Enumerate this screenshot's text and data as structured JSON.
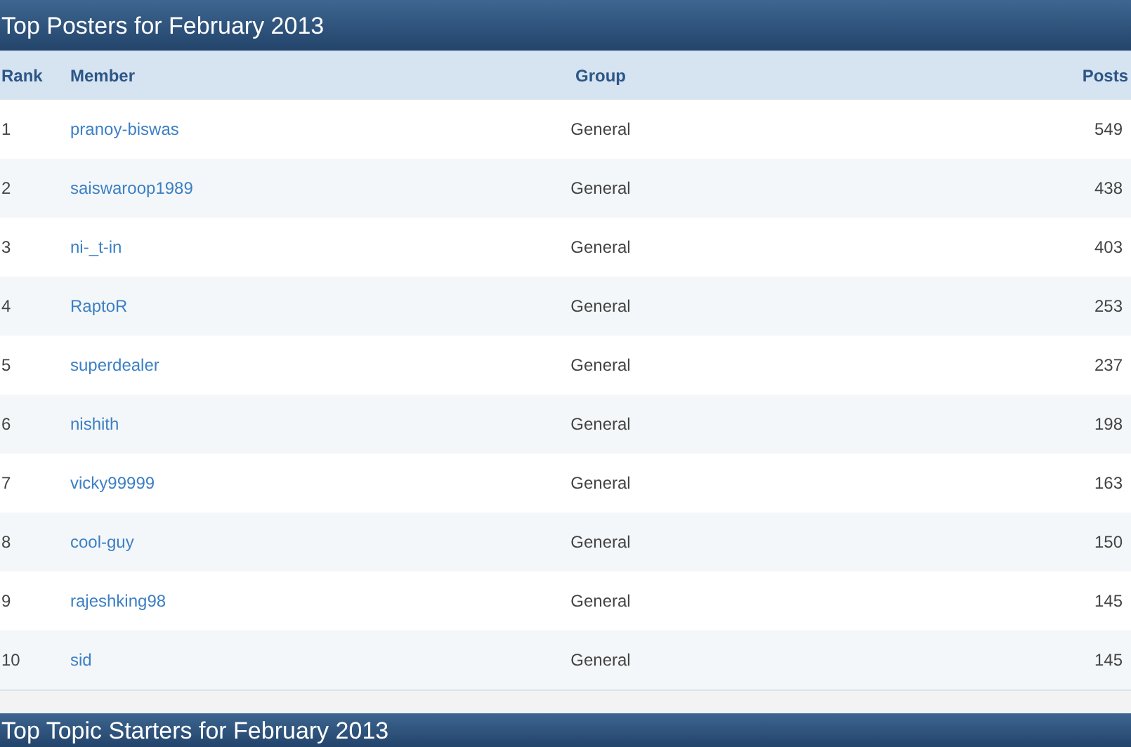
{
  "sections": [
    {
      "title": "Top Posters for February 2013",
      "columns": [
        "Rank",
        "Member",
        "Group",
        "Posts"
      ],
      "rows": [
        {
          "rank": "1",
          "member": "pranoy-biswas",
          "group": "General",
          "posts": "549"
        },
        {
          "rank": "2",
          "member": "saiswaroop1989",
          "group": "General",
          "posts": "438"
        },
        {
          "rank": "3",
          "member": "ni-_t-in",
          "group": "General",
          "posts": "403"
        },
        {
          "rank": "4",
          "member": "RaptoR",
          "group": "General",
          "posts": "253"
        },
        {
          "rank": "5",
          "member": "superdealer",
          "group": "General",
          "posts": "237"
        },
        {
          "rank": "6",
          "member": "nishith",
          "group": "General",
          "posts": "198"
        },
        {
          "rank": "7",
          "member": "vicky99999",
          "group": "General",
          "posts": "163"
        },
        {
          "rank": "8",
          "member": "cool-guy",
          "group": "General",
          "posts": "150"
        },
        {
          "rank": "9",
          "member": "rajeshking98",
          "group": "General",
          "posts": "145"
        },
        {
          "rank": "10",
          "member": "sid",
          "group": "General",
          "posts": "145"
        }
      ]
    },
    {
      "title": "Top Topic Starters for February 2013"
    }
  ]
}
